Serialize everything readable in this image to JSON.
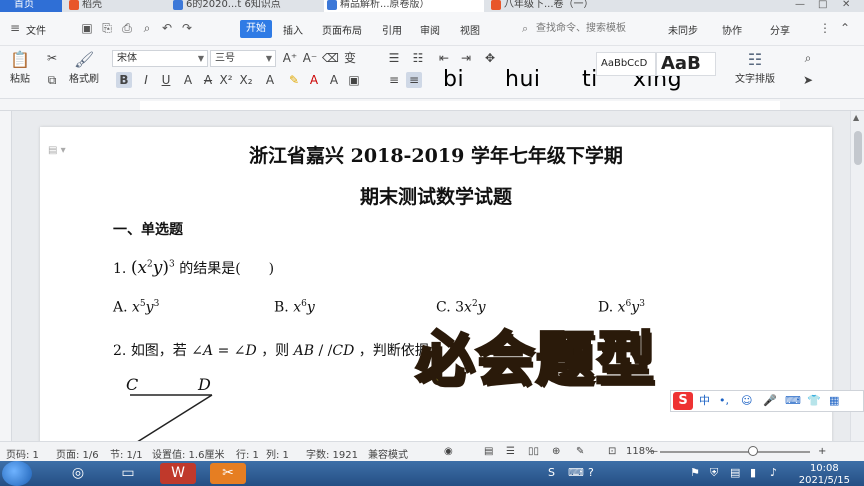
{
  "tabs": {
    "home": "首页",
    "t1": "稻壳",
    "t2": "6的2020...t 6知识点",
    "t3": "精品解析...原卷版）",
    "t4": "八年级下...卷（一）"
  },
  "window": {
    "minimize": "—",
    "restore": "□",
    "close": "✕"
  },
  "menu": {
    "file": "文件",
    "start": "开始",
    "items": [
      "插入",
      "页面布局",
      "引用",
      "审阅",
      "视图"
    ],
    "search_placeholder": "查找命令、搜索模板",
    "sync": "未同步",
    "collab": "协作",
    "share": "分享"
  },
  "ribbon": {
    "paste": "粘贴",
    "format_painter": "格式刷",
    "font_name": "宋体",
    "font_size": "三号",
    "style1": "AaBbCcD",
    "style2": "AaB",
    "text_layout": "文字排版",
    "pinyin": [
      "bi",
      "hui",
      "ti",
      "xing"
    ]
  },
  "document": {
    "title_line1": "浙江省嘉兴 2018-2019 学年七年级下学期",
    "title_line2": "期末测试数学试题",
    "section1": "一、单选题",
    "q1_num": "1.",
    "q1_tail": "的结果是(　　)",
    "q1_options": [
      "A.",
      "B.",
      "C.",
      "D."
    ],
    "q2_num": "2.",
    "q2_text1": "如图，若",
    "q2_text2": "，则",
    "q2_text3": "，判断依据",
    "label_c": "C",
    "label_d": "D"
  },
  "overlay": {
    "text": "必会题型"
  },
  "ime": {
    "zh": "中"
  },
  "status": {
    "page_code": "页码: 1",
    "page": "页面: 1/6",
    "section": "节: 1/1",
    "setting": "设置值: 1.6厘米",
    "row": "行: 1",
    "col": "列: 1",
    "words": "字数: 1921",
    "compat": "兼容模式",
    "zoom": "118%",
    "zoom_minus": "—",
    "zoom_plus": "+"
  },
  "taskbar": {
    "time": "10:08",
    "date": "2021/5/15"
  }
}
